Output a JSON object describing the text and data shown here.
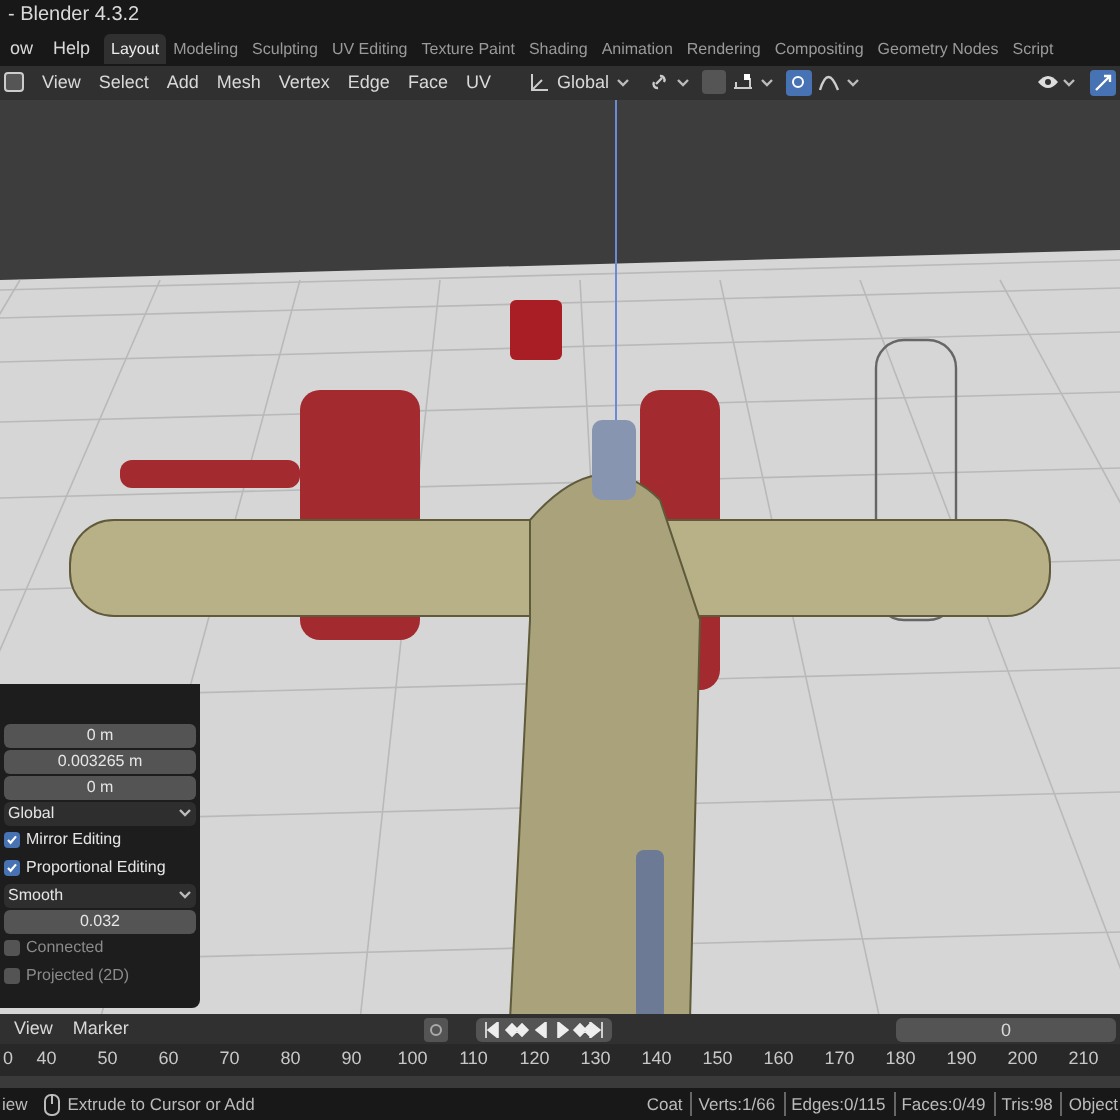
{
  "window": {
    "title": "- Blender 4.3.2"
  },
  "menu": [
    "ow",
    "Help"
  ],
  "workspaces": [
    {
      "label": "Layout",
      "selected": true
    },
    {
      "label": "Modeling",
      "selected": false
    },
    {
      "label": "Sculpting",
      "selected": false
    },
    {
      "label": "UV Editing",
      "selected": false
    },
    {
      "label": "Texture Paint",
      "selected": false
    },
    {
      "label": "Shading",
      "selected": false
    },
    {
      "label": "Animation",
      "selected": false
    },
    {
      "label": "Rendering",
      "selected": false
    },
    {
      "label": "Compositing",
      "selected": false
    },
    {
      "label": "Geometry Nodes",
      "selected": false
    },
    {
      "label": "Script",
      "selected": false
    }
  ],
  "header": {
    "menus": [
      "View",
      "Select",
      "Add",
      "Mesh",
      "Vertex",
      "Edge",
      "Face",
      "UV"
    ],
    "orientation": "Global",
    "proportional_editing": true,
    "gizmos": true
  },
  "operator_panel": {
    "fields": [
      {
        "kind": "number",
        "value": "0 m"
      },
      {
        "kind": "number",
        "value": "0.003265 m"
      },
      {
        "kind": "number",
        "value": "0 m"
      },
      {
        "kind": "dropdown",
        "value": "Global"
      },
      {
        "kind": "checkbox",
        "label": "Mirror Editing",
        "checked": true
      },
      {
        "kind": "checkbox",
        "label": "Proportional Editing",
        "checked": true
      },
      {
        "kind": "dropdown",
        "value": "Smooth"
      },
      {
        "kind": "slider",
        "value": "0.032"
      },
      {
        "kind": "checkbox",
        "label": "Connected",
        "checked": false
      },
      {
        "kind": "checkbox",
        "label": "Projected (2D)",
        "checked": false
      }
    ]
  },
  "timeline": {
    "menus": [
      "View",
      "Marker"
    ],
    "auto_keying": false,
    "current_frame": "0",
    "ruler": [
      "0",
      "40",
      "50",
      "60",
      "70",
      "80",
      "90",
      "100",
      "110",
      "120",
      "130",
      "140",
      "150",
      "160",
      "170",
      "180",
      "190",
      "200",
      "210"
    ]
  },
  "status_bar": {
    "left": "iew",
    "hint": "Extrude to Cursor or Add",
    "stats": [
      "Coat",
      "Verts:1/66",
      "Edges:0/115",
      "Faces:0/49",
      "Tris:98",
      "Object"
    ]
  }
}
